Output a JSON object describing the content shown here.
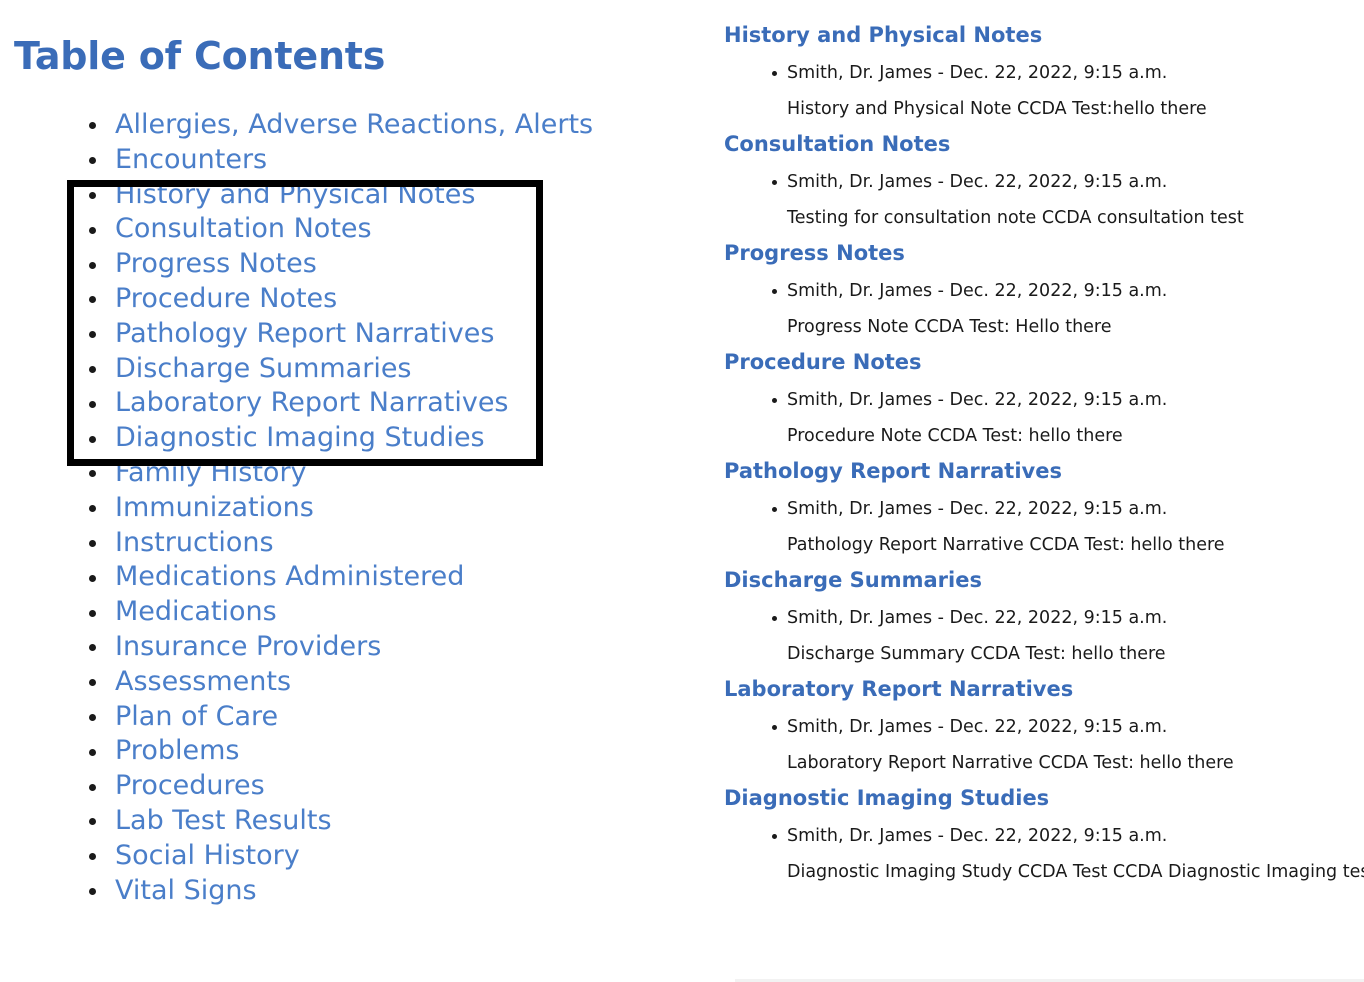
{
  "toc": {
    "title": "Table of Contents",
    "items": [
      {
        "label": "Allergies, Adverse Reactions, Alerts"
      },
      {
        "label": "Encounters"
      },
      {
        "label": "History and Physical Notes"
      },
      {
        "label": "Consultation Notes"
      },
      {
        "label": "Progress Notes"
      },
      {
        "label": "Procedure Notes"
      },
      {
        "label": "Pathology Report Narratives"
      },
      {
        "label": "Discharge Summaries"
      },
      {
        "label": "Laboratory Report Narratives"
      },
      {
        "label": "Diagnostic Imaging Studies"
      },
      {
        "label": "Family History"
      },
      {
        "label": "Immunizations"
      },
      {
        "label": "Instructions"
      },
      {
        "label": "Medications Administered"
      },
      {
        "label": "Medications"
      },
      {
        "label": "Insurance Providers"
      },
      {
        "label": "Assessments"
      },
      {
        "label": "Plan of Care"
      },
      {
        "label": "Problems"
      },
      {
        "label": "Procedures"
      },
      {
        "label": "Lab Test Results"
      },
      {
        "label": "Social History"
      },
      {
        "label": "Vital Signs"
      }
    ],
    "highlight": {
      "first_item": "History and Physical Notes",
      "last_item": "Diagnostic Imaging Studies"
    }
  },
  "notes": {
    "sections": [
      {
        "heading": "History and Physical Notes",
        "author": "Smith, Dr. James - Dec. 22, 2022, 9:15 a.m.",
        "body": "History and Physical Note CCDA Test:hello there"
      },
      {
        "heading": "Consultation Notes",
        "author": "Smith, Dr. James - Dec. 22, 2022, 9:15 a.m.",
        "body": "Testing for consultation note CCDA consultation test"
      },
      {
        "heading": "Progress Notes",
        "author": "Smith, Dr. James - Dec. 22, 2022, 9:15 a.m.",
        "body": "Progress Note CCDA Test: Hello there"
      },
      {
        "heading": "Procedure Notes",
        "author": "Smith, Dr. James - Dec. 22, 2022, 9:15 a.m.",
        "body": "Procedure Note CCDA Test: hello there"
      },
      {
        "heading": "Pathology Report Narratives",
        "author": "Smith, Dr. James - Dec. 22, 2022, 9:15 a.m.",
        "body": "Pathology Report Narrative CCDA Test: hello there"
      },
      {
        "heading": "Discharge Summaries",
        "author": "Smith, Dr. James - Dec. 22, 2022, 9:15 a.m.",
        "body": "Discharge Summary CCDA Test: hello there"
      },
      {
        "heading": "Laboratory Report Narratives",
        "author": "Smith, Dr. James - Dec. 22, 2022, 9:15 a.m.",
        "body": "Laboratory Report Narrative CCDA Test: hello there"
      },
      {
        "heading": "Diagnostic Imaging Studies",
        "author": "Smith, Dr. James - Dec. 22, 2022, 9:15 a.m.",
        "body": "Diagnostic Imaging Study CCDA Test CCDA Diagnostic Imaging test."
      }
    ]
  },
  "colors": {
    "link_blue": "#4a7ec9",
    "heading_blue": "#3a6cb8",
    "text": "#1a1a1a",
    "highlight_border": "#000000"
  }
}
